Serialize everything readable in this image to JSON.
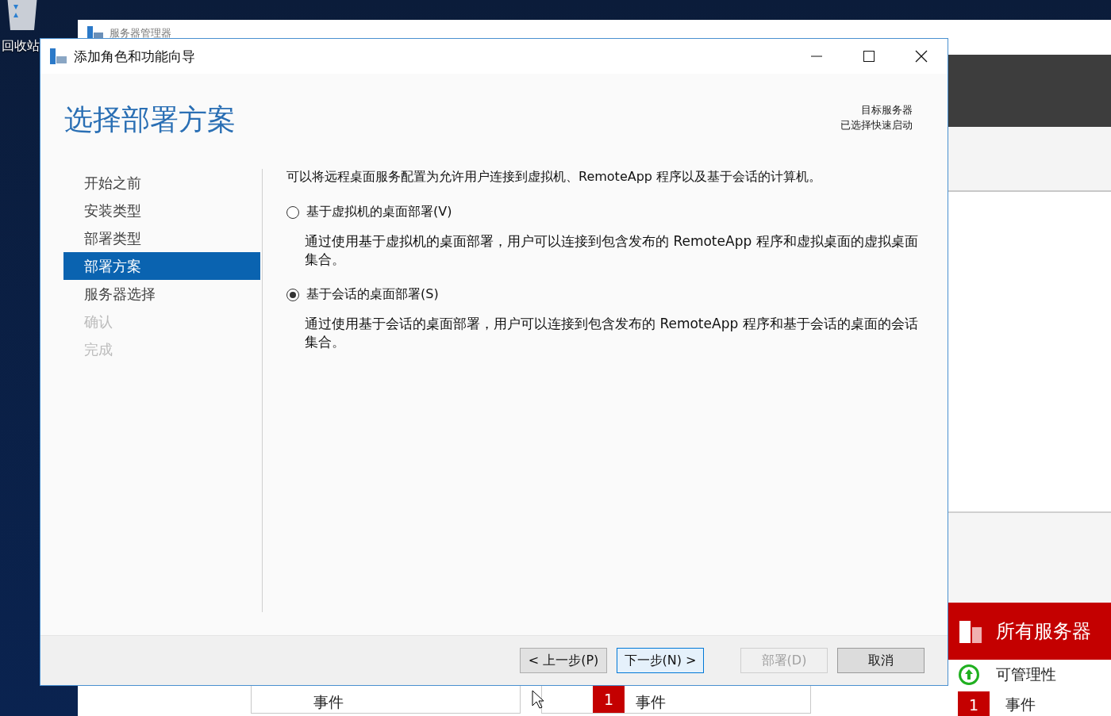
{
  "desktop": {
    "recycle_bin": {
      "label": "回收站"
    }
  },
  "server_manager": {
    "title": "服务器管理器",
    "tiles": [
      {
        "title": "所有服务器",
        "rows": [
          {
            "kind": "status",
            "label": "可管理性"
          },
          {
            "kind": "count",
            "count": "1",
            "label": "事件"
          }
        ]
      }
    ],
    "bottom_tiles": [
      {
        "kind": "plain",
        "label": "事件"
      },
      {
        "kind": "count",
        "count": "1",
        "label": "事件"
      }
    ]
  },
  "dialog": {
    "title": "添加角色和功能向导",
    "page_title": "选择部署方案",
    "target_server": [
      "目标服务器",
      "已选择快速启动"
    ],
    "steps": [
      {
        "label": "开始之前",
        "selected": false,
        "disabled": false
      },
      {
        "label": "安装类型",
        "selected": false,
        "disabled": false
      },
      {
        "label": "部署类型",
        "selected": false,
        "disabled": false
      },
      {
        "label": "部署方案",
        "selected": true,
        "disabled": false
      },
      {
        "label": "服务器选择",
        "selected": false,
        "disabled": false
      },
      {
        "label": "确认",
        "selected": false,
        "disabled": true
      },
      {
        "label": "完成",
        "selected": false,
        "disabled": true
      }
    ],
    "description": "可以将远程桌面服务配置为允许用户连接到虚拟机、RemoteApp 程序以及基于会话的计算机。",
    "options": [
      {
        "label": "基于虚拟机的桌面部署(V)",
        "description": "通过使用基于虚拟机的桌面部署，用户可以连接到包含发布的 RemoteApp 程序和虚拟桌面的虚拟桌面集合。",
        "selected": false
      },
      {
        "label": "基于会话的桌面部署(S)",
        "description": "通过使用基于会话的桌面部署，用户可以连接到包含发布的 RemoteApp 程序和基于会话的桌面的会话集合。",
        "selected": true
      }
    ],
    "buttons": [
      {
        "label": "< 上一步(P)",
        "kind": "normal",
        "disabled": false
      },
      {
        "label": "下一步(N) >",
        "kind": "default",
        "disabled": false
      },
      {
        "label": "部署(D)",
        "kind": "normal",
        "disabled": true
      },
      {
        "label": "取消",
        "kind": "cancel",
        "disabled": false
      }
    ]
  }
}
